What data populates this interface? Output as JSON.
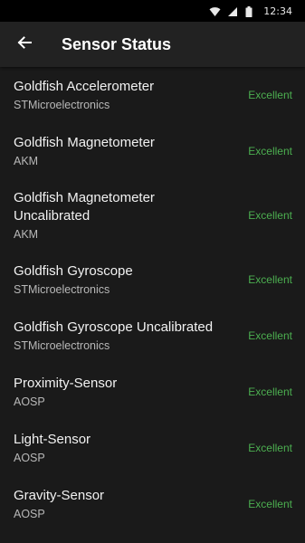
{
  "status_bar": {
    "time": "12:34",
    "icons": [
      "wifi-icon",
      "cellular-signal-icon",
      "battery-icon"
    ]
  },
  "app_bar": {
    "back_icon": "arrow-left-icon",
    "title": "Sensor Status"
  },
  "colors": {
    "background": "#1a1a1a",
    "app_bar": "#222222",
    "status_bar": "#000000",
    "status_good": "#4caf50"
  },
  "sensors": [
    {
      "name": "Goldfish Accelerometer",
      "vendor": "STMicroelectronics",
      "status": "Excellent"
    },
    {
      "name": "Goldfish Magnetometer",
      "vendor": "AKM",
      "status": "Excellent"
    },
    {
      "name": "Goldfish Magnetometer Uncalibrated",
      "vendor": "AKM",
      "status": "Excellent"
    },
    {
      "name": "Goldfish Gyroscope",
      "vendor": "STMicroelectronics",
      "status": "Excellent"
    },
    {
      "name": "Goldfish Gyroscope Uncalibrated",
      "vendor": "STMicroelectronics",
      "status": "Excellent"
    },
    {
      "name": "Proximity-Sensor",
      "vendor": "AOSP",
      "status": "Excellent"
    },
    {
      "name": "Light-Sensor",
      "vendor": "AOSP",
      "status": "Excellent"
    },
    {
      "name": "Gravity-Sensor",
      "vendor": "AOSP",
      "status": "Excellent"
    }
  ]
}
